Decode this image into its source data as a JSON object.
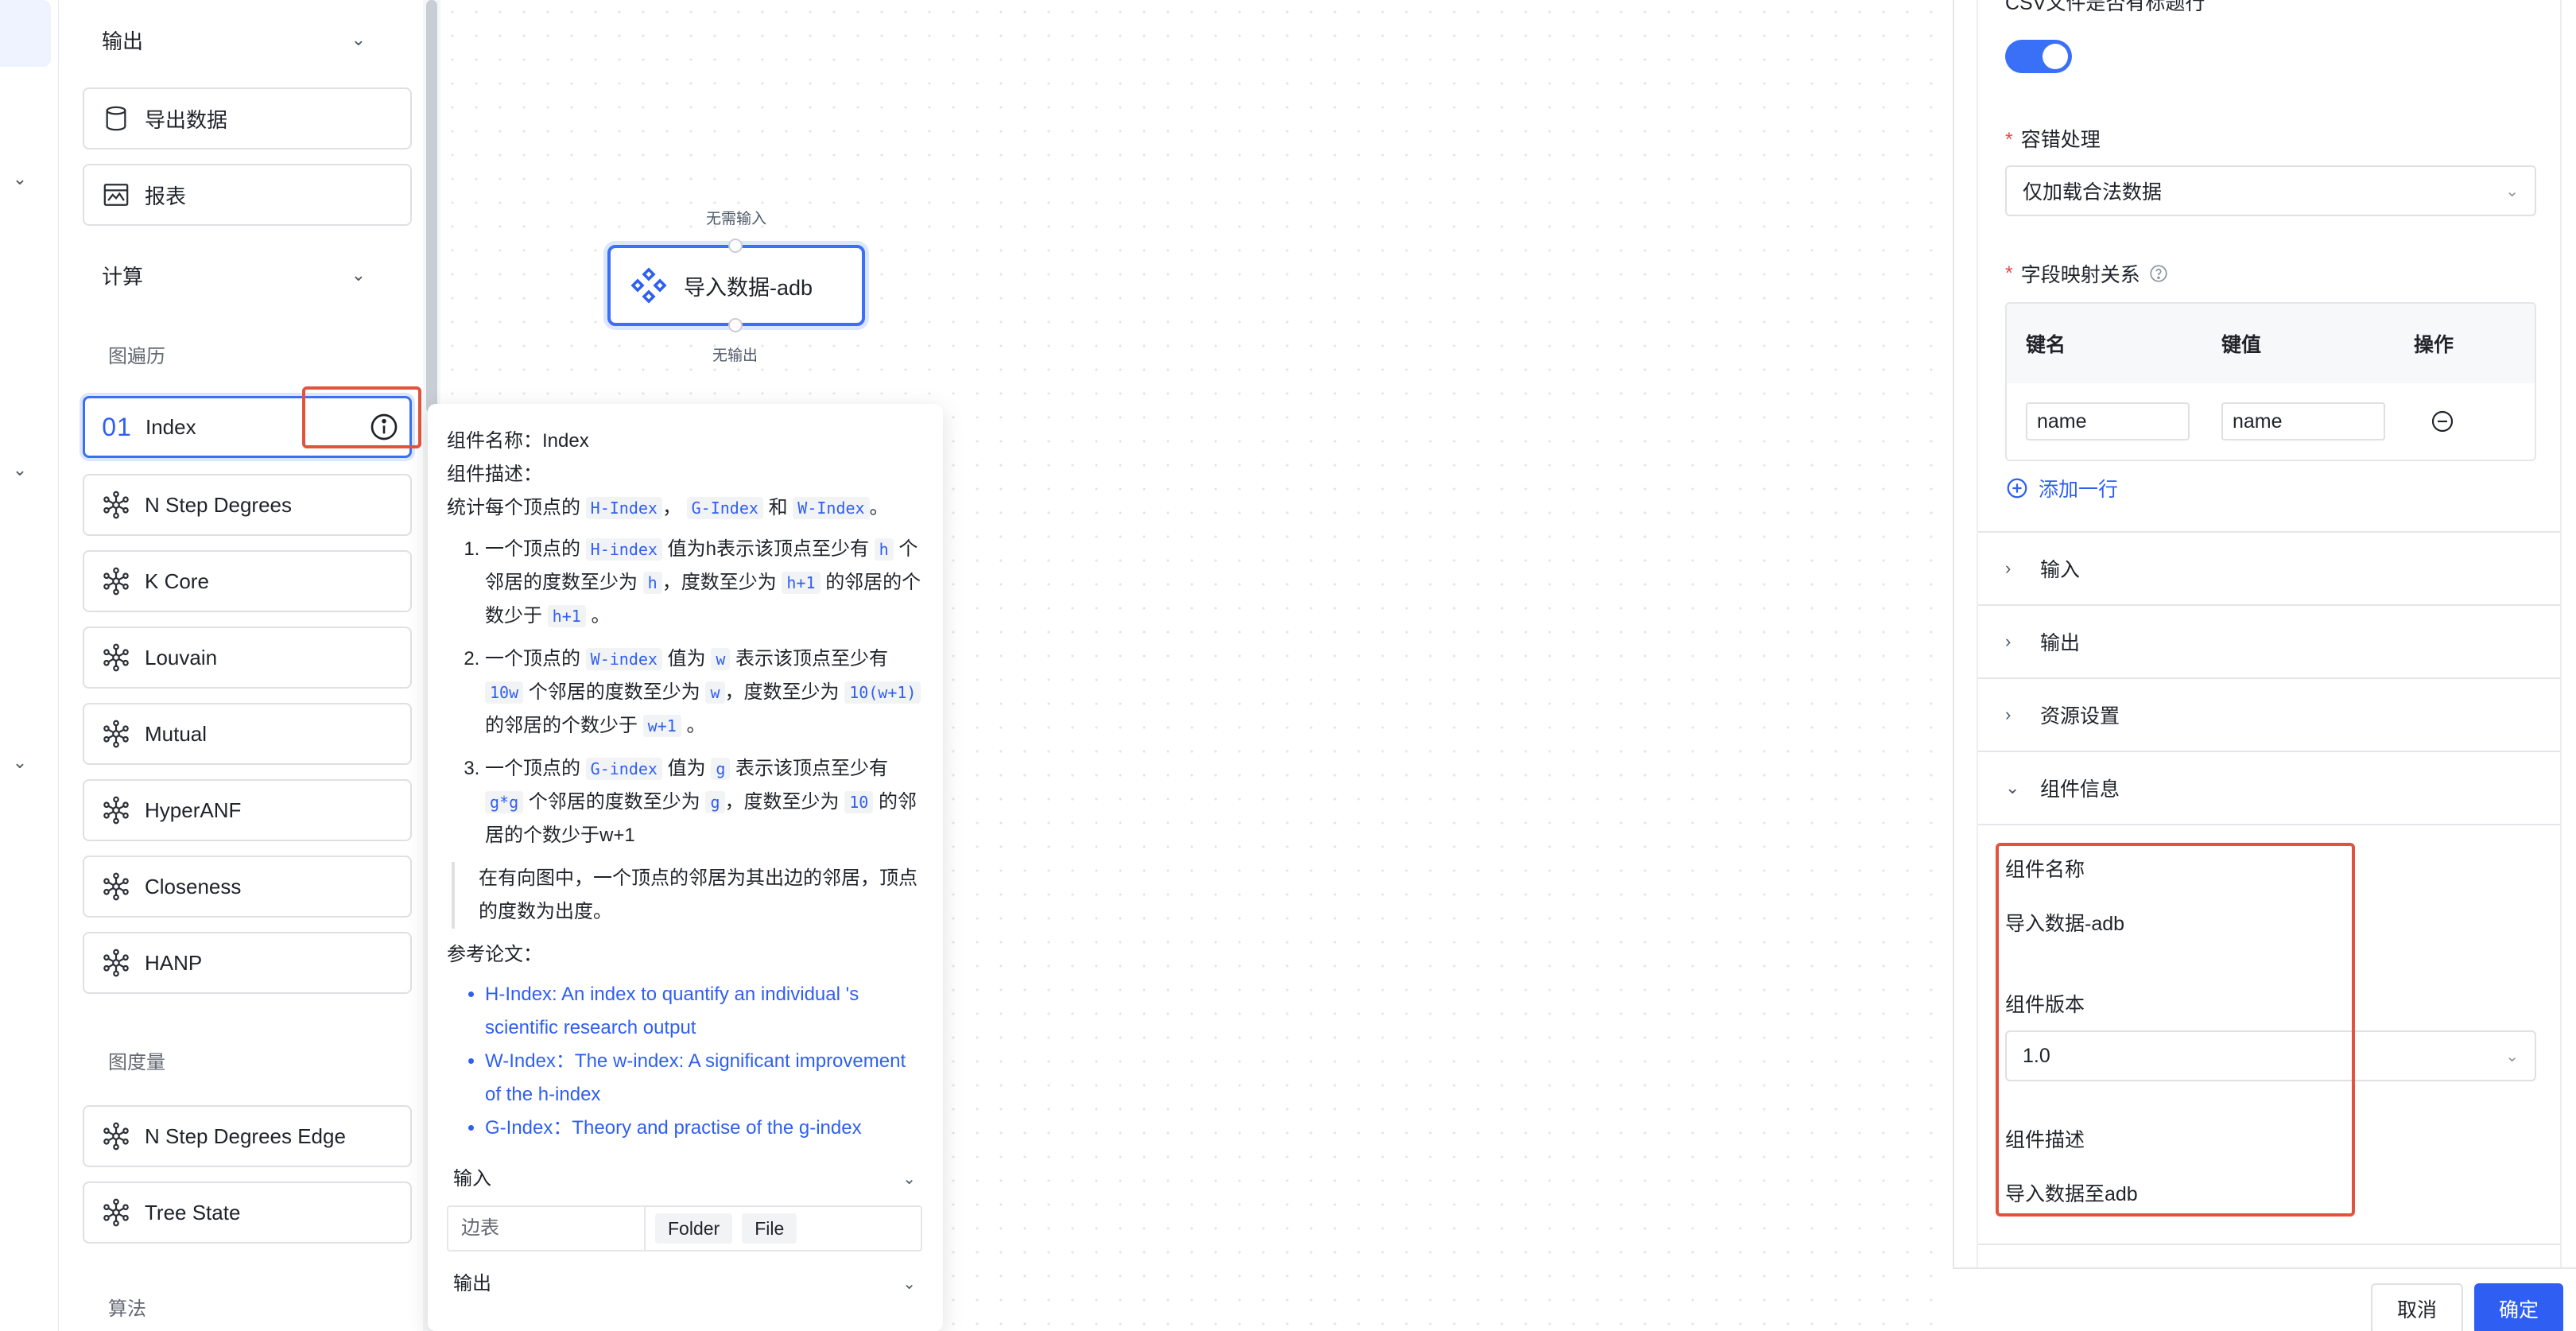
{
  "palette": {
    "sections": {
      "output": "输出",
      "compute": "计算"
    },
    "output_items": [
      "导出数据",
      "报表"
    ],
    "traversal_group": "图遍历",
    "traversal_items": [
      "Index",
      "N Step Degrees",
      "K Core",
      "Louvain",
      "Mutual",
      "HyperANF",
      "Closeness",
      "HANP"
    ],
    "index_badge": "01",
    "metric_group": "图度量",
    "metric_items": [
      "N Step Degrees Edge",
      "Tree State"
    ],
    "algo_group": "算法"
  },
  "canvas": {
    "node_title": "导入数据-adb",
    "input_label": "无需输入",
    "output_label": "无输出"
  },
  "tooltip": {
    "name_label": "组件名称：",
    "name_value": "Index",
    "desc_label": "组件描述：",
    "intro_a": "统计每个顶点的",
    "intro_code1": "H-Index",
    "intro_sep1": "，",
    "intro_code2": "G-Index",
    "intro_and": "和",
    "intro_code3": "W-Index",
    "intro_end": "。",
    "l1_a": "一个顶点的",
    "l1_code1": "H-index",
    "l1_b": "值为h表示该顶点至少有",
    "l1_code2": "h",
    "l1_c": "个邻居的度数至少为",
    "l1_code3": "h",
    "l1_d": "，度数至少为",
    "l1_code4": "h+1",
    "l1_e": "的邻居的个数少于",
    "l1_code5": "h+1",
    "l1_f": "。",
    "l2_a": "一个顶点的",
    "l2_code1": "W-index",
    "l2_b": "值为",
    "l2_code2": "w",
    "l2_c": "表示该顶点至少有",
    "l2_code3": "10w",
    "l2_d": "个邻居的度数至少为",
    "l2_code4": "w",
    "l2_e": "，度数至少为",
    "l2_code5": "10(w+1)",
    "l2_f": "的邻居的个数少于",
    "l2_code6": "w+1",
    "l2_g": "。",
    "l3_a": "一个顶点的",
    "l3_code1": "G-index",
    "l3_b": "值为",
    "l3_code2": "g",
    "l3_c": "表示该顶点至少有",
    "l3_code3": "g*g",
    "l3_d": "个邻居的度数至少为",
    "l3_code4": "g",
    "l3_e": "，度数至少为",
    "l3_code5": "10",
    "l3_f": "的邻居的个数少于w+1",
    "quote": "在有向图中，一个顶点的邻居为其出边的邻居，顶点的度数为出度。",
    "refs_label": "参考论文：",
    "refs": [
      "H-Index: An index to quantify an individual 's scientific research output",
      "W-Index：The w-index: A significant improvement of the h-index",
      "G-Index：Theory and practise of the g-index"
    ],
    "input_section": "输入",
    "port_name": "边表",
    "port_tags": [
      "Folder",
      "File"
    ],
    "output_section": "输出"
  },
  "panel": {
    "csv_header_label": "CSV文件是否有标题行",
    "fault_label": "容错处理",
    "fault_value": "仅加载合法数据",
    "mapping_label": "字段映射关系",
    "table_headers": [
      "键名",
      "键值",
      "操作"
    ],
    "row_key": "name",
    "row_value": "name",
    "add_row": "添加一行",
    "collapses": [
      "输入",
      "输出",
      "资源设置",
      "组件信息"
    ],
    "info_name_label": "组件名称",
    "info_name_value": "导入数据-adb",
    "info_version_label": "组件版本",
    "info_version_value": "1.0",
    "info_desc_label": "组件描述",
    "info_desc_value": "导入数据至adb",
    "cancel": "取消",
    "ok": "确定"
  }
}
